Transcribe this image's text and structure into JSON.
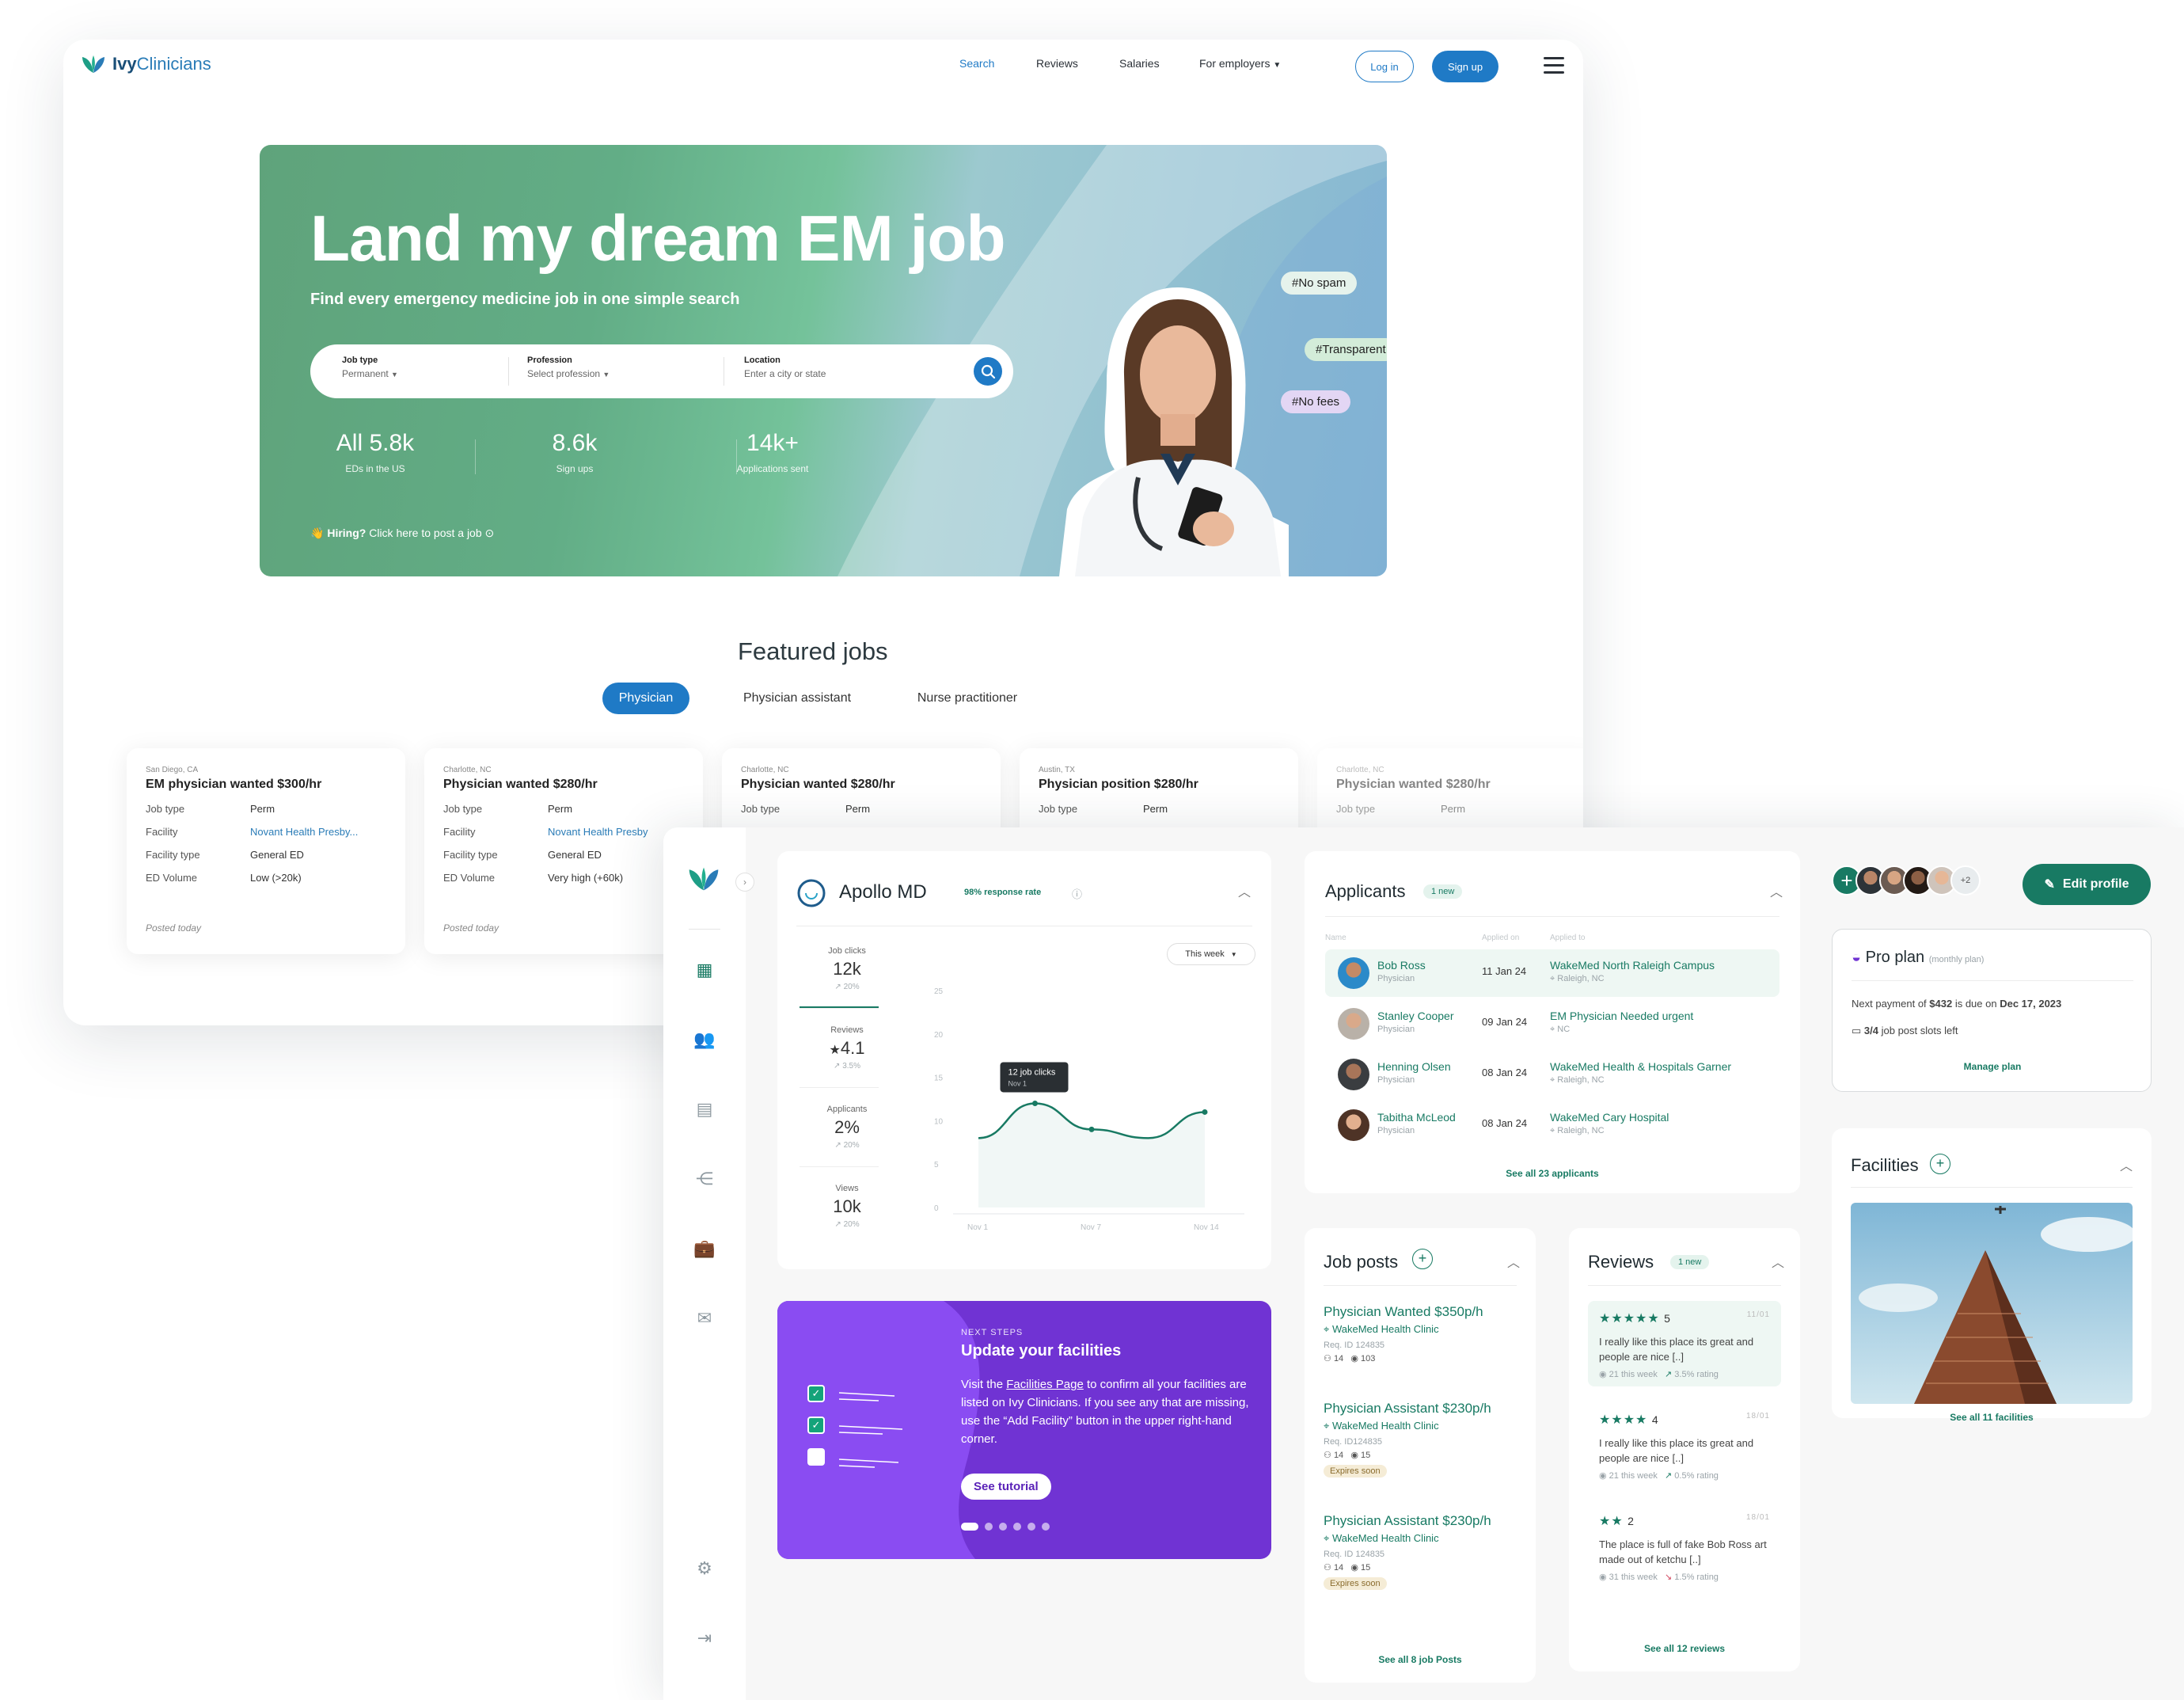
{
  "site": {
    "logo": {
      "text_a": "Ivy",
      "text_b": "Clinicians"
    },
    "nav": [
      "Search",
      "Reviews",
      "Salaries",
      "For employers"
    ],
    "login": "Log in",
    "signup": "Sign up",
    "hero": {
      "title": "Land my dream EM job",
      "subtitle": "Find every emergency medicine job in one simple search",
      "fields": [
        {
          "label": "Job type",
          "value": "Permanent"
        },
        {
          "label": "Profession",
          "value": "Select profession"
        },
        {
          "label": "Location",
          "placeholder": "Enter a city or state"
        }
      ],
      "stats": [
        {
          "num": "All 5.8k",
          "label": "EDs in the US"
        },
        {
          "num": "8.6k",
          "label": "Sign ups"
        },
        {
          "num": "14k+",
          "label": "Applications sent"
        }
      ],
      "hiring_bold": "Hiring?",
      "hiring_rest": " Click here to post a job",
      "tags": [
        "#No spam",
        "#Transparent",
        "#No fees"
      ]
    },
    "featured": {
      "title": "Featured jobs",
      "tabs": [
        "Physician",
        "Physician assistant",
        "Nurse practitioner"
      ],
      "row_labels": [
        "Job type",
        "Facility",
        "Facility type",
        "ED Volume"
      ],
      "cards": [
        {
          "city": "San Diego, CA",
          "title": "EM physician wanted $300/hr",
          "job_type": "Perm",
          "facility": "Novant Health Presby...",
          "facility_type": "General ED",
          "volume": "Low (>20k)",
          "posted": "Posted today"
        },
        {
          "city": "Charlotte, NC",
          "title": "Physician wanted $280/hr",
          "job_type": "Perm",
          "facility": "Novant Health Presby",
          "facility_type": "General ED",
          "volume": "Very high (+60k)",
          "posted": "Posted today"
        },
        {
          "city": "Charlotte, NC",
          "title": "Physician wanted $280/hr",
          "job_type": "Perm"
        },
        {
          "city": "Austin, TX",
          "title": "Physician position $280/hr",
          "job_type": "Perm"
        },
        {
          "city": "Charlotte, NC",
          "title": "Physician wanted $280/hr",
          "job_type": "Perm"
        }
      ]
    }
  },
  "dash": {
    "company": {
      "name": "Apollo MD",
      "response": "98% response rate"
    },
    "range": "This week",
    "kpis": [
      {
        "label": "Job clicks",
        "value": "12k",
        "delta": "20%"
      },
      {
        "label": "Reviews",
        "value": "4.1",
        "delta": "3.5%"
      },
      {
        "label": "Applicants",
        "value": "2%",
        "delta": "20%"
      },
      {
        "label": "Views",
        "value": "10k",
        "delta": "20%"
      }
    ],
    "chart_data": {
      "type": "line",
      "x": [
        "Nov 1",
        "Nov 4",
        "Nov 7",
        "Nov 10",
        "Nov 14"
      ],
      "categories": [
        "Nov 1",
        "Nov 7",
        "Nov 14"
      ],
      "values": [
        8,
        12,
        9,
        8,
        11
      ],
      "ylim": [
        0,
        25
      ],
      "yticks": [
        "25",
        "20",
        "15",
        "10",
        "5",
        "0"
      ],
      "tooltip": {
        "title": "12 job clicks",
        "sub": "Nov 1"
      }
    },
    "next": {
      "kicker": "NEXT STEPS",
      "title": "Update your facilities",
      "body_a": "Visit the ",
      "link": "Facilities Page",
      "body_b": " to confirm all your facilities are listed on Ivy Clinicians. If you see any that are missing, use the “Add Facility” button in the upper right-hand corner.",
      "cta": "See tutorial"
    },
    "applicants": {
      "title": "Applicants",
      "badge": "1 new",
      "cols": [
        "Name",
        "Applied on",
        "Applied to"
      ],
      "rows": [
        {
          "name": "Bob Ross",
          "role": "Physician",
          "date": "11 Jan 24",
          "to": "WakeMed North Raleigh Campus",
          "loc": "Raleigh, NC"
        },
        {
          "name": "Stanley Cooper",
          "role": "Physician",
          "date": "09 Jan 24",
          "to": "EM Physician Needed urgent",
          "loc": "NC"
        },
        {
          "name": "Henning Olsen",
          "role": "Physician",
          "date": "08 Jan 24",
          "to": "WakeMed Health & Hospitals Garner",
          "loc": "Raleigh, NC"
        },
        {
          "name": "Tabitha McLeod",
          "role": "Physician",
          "date": "08 Jan 24",
          "to": "WakeMed Cary Hospital",
          "loc": "Raleigh, NC"
        }
      ],
      "see_all": "See all 23 applicants"
    },
    "jobposts": {
      "title": "Job posts",
      "items": [
        {
          "title": "Physician Wanted $350p/h",
          "clinic": "WakeMed Health Clinic",
          "req": "Req. ID 124835",
          "apps": "14",
          "views": "103",
          "expires": ""
        },
        {
          "title": "Physician Assistant $230p/h",
          "clinic": "WakeMed Health Clinic",
          "req": "Req. ID124835",
          "apps": "14",
          "views": "15",
          "expires": "Expires soon"
        },
        {
          "title": "Physician Assistant $230p/h",
          "clinic": "WakeMed Health Clinic",
          "req": "Req. ID 124835",
          "apps": "14",
          "views": "15",
          "expires": "Expires soon"
        }
      ],
      "see_all": "See all 8 job Posts"
    },
    "reviews": {
      "title": "Reviews",
      "badge": "1 new",
      "items": [
        {
          "stars": "★★★★★",
          "score": "5",
          "date": "11/01",
          "text": "I really like this place its great and people are nice [..]",
          "week": "21 this week",
          "rating": "3.5% rating"
        },
        {
          "stars": "★★★★",
          "score": "4",
          "date": "18/01",
          "text": "I really like this place its great and people are nice [..]",
          "week": "21 this week",
          "rating": "0.5% rating"
        },
        {
          "stars": "★★",
          "score": "2",
          "date": "18/01",
          "text": "The place is full of fake Bob Ross art made out of ketchu [..]",
          "week": "31 this week",
          "rating": "1.5% rating"
        }
      ],
      "see_all": "See all 12 reviews"
    },
    "team_more": "+2",
    "edit_profile": "Edit profile",
    "plan": {
      "title": "Pro plan",
      "sub": "(monthly plan)",
      "payment_a": "Next payment of ",
      "amount": "$432",
      "payment_b": " is due on ",
      "date": "Dec 17, 2023",
      "slots_a": "3/4",
      "slots_b": " job post slots left",
      "manage": "Manage plan"
    },
    "facilities": {
      "title": "Facilities",
      "see_all": "See all 11 facilities"
    }
  }
}
